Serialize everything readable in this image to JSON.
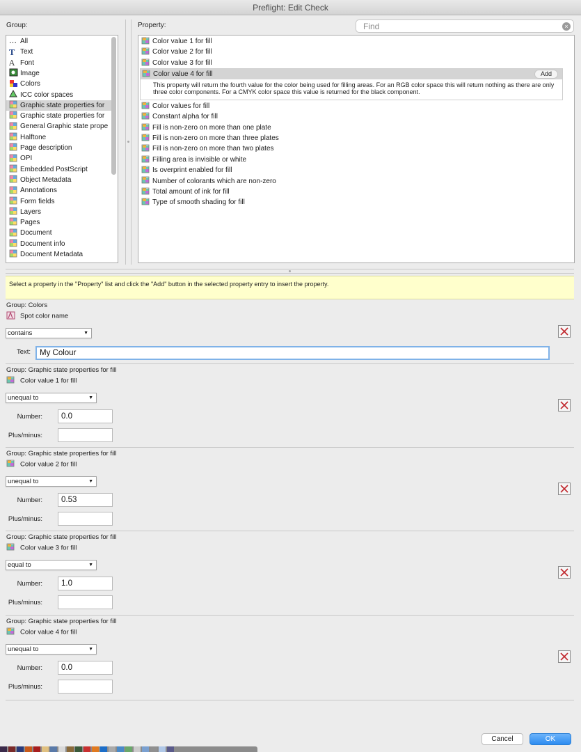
{
  "window": {
    "title": "Preflight: Edit Check"
  },
  "group_panel": {
    "label": "Group:",
    "items": [
      {
        "label": "All",
        "icon": "ellipsis-icon"
      },
      {
        "label": "Text",
        "icon": "text-icon"
      },
      {
        "label": "Font",
        "icon": "font-icon"
      },
      {
        "label": "Image",
        "icon": "image-icon"
      },
      {
        "label": "Colors",
        "icon": "colors-icon"
      },
      {
        "label": "ICC color spaces",
        "icon": "icc-icon"
      },
      {
        "label": "Graphic state properties for",
        "icon": "graphic-state-fill-icon"
      },
      {
        "label": "Graphic state properties for",
        "icon": "graphic-state-stroke-icon"
      },
      {
        "label": "General Graphic state prope",
        "icon": "general-graphic-state-icon"
      },
      {
        "label": "Halftone",
        "icon": "halftone-icon"
      },
      {
        "label": "Page description",
        "icon": "page-description-icon"
      },
      {
        "label": "OPI",
        "icon": "opi-icon"
      },
      {
        "label": "Embedded PostScript",
        "icon": "postscript-icon"
      },
      {
        "label": "Object Metadata",
        "icon": "object-metadata-icon"
      },
      {
        "label": "Annotations",
        "icon": "annotations-icon"
      },
      {
        "label": "Form fields",
        "icon": "form-fields-icon"
      },
      {
        "label": "Layers",
        "icon": "layers-icon"
      },
      {
        "label": "Pages",
        "icon": "pages-icon"
      },
      {
        "label": "Document",
        "icon": "document-icon"
      },
      {
        "label": "Document info",
        "icon": "document-info-icon"
      },
      {
        "label": "Document Metadata",
        "icon": "document-metadata-icon"
      }
    ],
    "selected_index": 6
  },
  "property_panel": {
    "label": "Property:",
    "search_placeholder": "Find",
    "items": [
      "Color value 1 for fill",
      "Color value 2 for fill",
      "Color value 3 for fill",
      "Color value 4 for fill",
      "Color values for fill",
      "Constant alpha for fill",
      "Fill is non-zero on more than one plate",
      "Fill is non-zero on more than three plates",
      "Fill is non-zero on more than two plates",
      "Filling area is invisible or white",
      "Is overprint enabled for fill",
      "Number of colorants which are non-zero",
      "Total amount of ink for fill",
      "Type of smooth shading for fill"
    ],
    "selected": {
      "label": "Color value 4 for fill",
      "add_label": "Add",
      "description": "This property will return the fourth value for the color being used for filling areas. For an RGB color space this will return nothing as there are only three color components. For a CMYK color space this value is returned for the black component."
    }
  },
  "hint": "Select a property in the \"Property\" list and click the \"Add\" button in the selected property entry to insert the property.",
  "criteria": [
    {
      "group": "Group:  Colors",
      "property": "Spot color name",
      "operator": "contains",
      "fields": [
        {
          "label": "Text:",
          "value": "My Colour"
        }
      ]
    },
    {
      "group": "Group:  Graphic state properties for fill",
      "property": "Color value 1 for fill",
      "operator": "unequal to",
      "fields": [
        {
          "label": "Number:",
          "value": "0.0"
        },
        {
          "label": "Plus/minus:",
          "value": ""
        }
      ]
    },
    {
      "group": "Group:  Graphic state properties for fill",
      "property": "Color value 2 for fill",
      "operator": "unequal to",
      "fields": [
        {
          "label": "Number:",
          "value": "0.53"
        },
        {
          "label": "Plus/minus:",
          "value": ""
        }
      ]
    },
    {
      "group": "Group:  Graphic state properties for fill",
      "property": "Color value 3 for fill",
      "operator": "equal to",
      "fields": [
        {
          "label": "Number:",
          "value": "1.0"
        },
        {
          "label": "Plus/minus:",
          "value": ""
        }
      ]
    },
    {
      "group": "Group:  Graphic state properties for fill",
      "property": "Color value 4 for fill",
      "operator": "unequal to",
      "fields": [
        {
          "label": "Number:",
          "value": "0.0"
        },
        {
          "label": "Plus/minus:",
          "value": ""
        }
      ]
    }
  ],
  "buttons": {
    "cancel": "Cancel",
    "ok": "OK"
  },
  "colors": {
    "ok_blue": "#2d8cf0",
    "hint_yellow": "#ffffcc",
    "selection_gray": "#d4d4d4",
    "delete_red": "#c0282d"
  }
}
